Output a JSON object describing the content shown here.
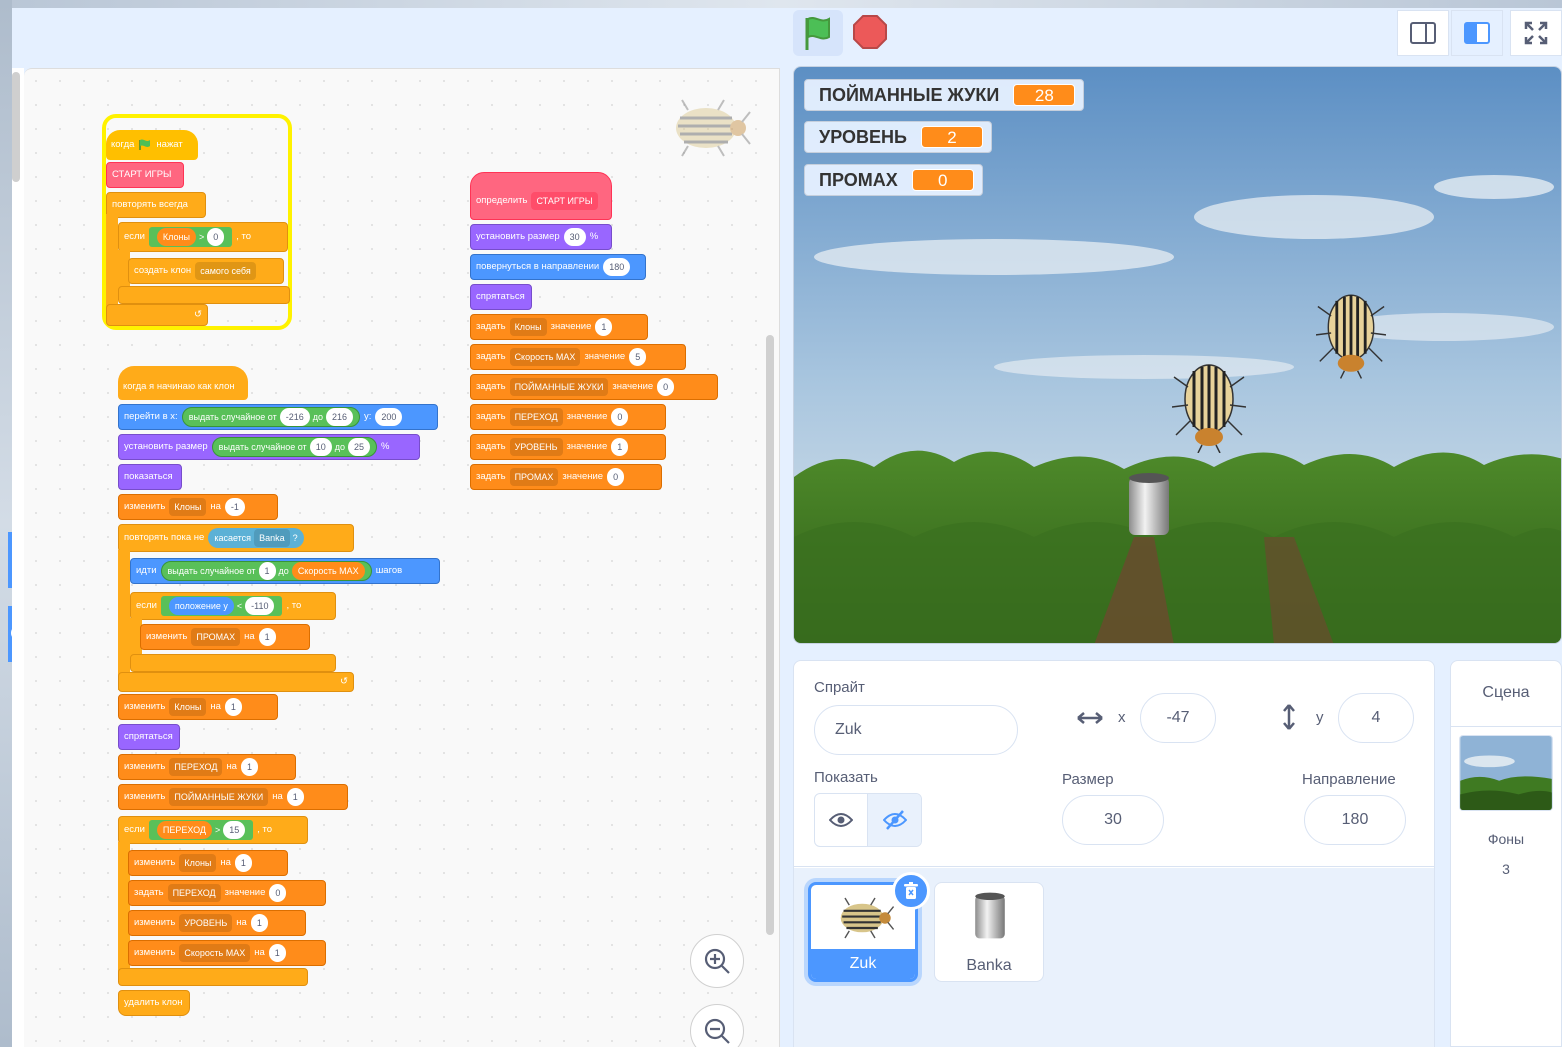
{
  "header": {
    "flag_icon": "green-flag-icon",
    "stop_icon": "stop-icon",
    "view_icons": [
      "small-stage-icon",
      "large-stage-icon",
      "fullscreen-icon"
    ]
  },
  "left_tab": {
    "partial_text": "e"
  },
  "scripts": {
    "s1": {
      "hat_when": "когда",
      "hat_clicked": "нажат",
      "call_start": "СТАРТ ИГРЫ",
      "forever": "повторять всегда",
      "if": "если",
      "then": ", то",
      "var_clones": "Клоны",
      "gt": ">",
      "zero": "0",
      "create_clone": "создать клон",
      "myself": "самого себя"
    },
    "s2": {
      "define": "определить",
      "proc_name": "СТАРТ ИГРЫ",
      "set_size": "установить размер",
      "size_val": "30",
      "percent": "%",
      "point_dir": "повернуться в направлении",
      "dir_val": "180",
      "hide": "спрятаться",
      "set": "задать",
      "to_value": "значение",
      "vars": [
        {
          "name": "Клоны",
          "val": "1"
        },
        {
          "name": "Скорость MAX",
          "val": "5"
        },
        {
          "name": "ПОЙМАННЫЕ ЖУКИ",
          "val": "0"
        },
        {
          "name": "ПЕРЕХОД",
          "val": "0"
        },
        {
          "name": "УРОВЕНЬ",
          "val": "1"
        },
        {
          "name": "ПРОМАХ",
          "val": "0"
        }
      ]
    },
    "s3": {
      "hat": "когда я начинаю как клон",
      "goto": "перейти в x:",
      "pick_random": "выдать случайное от",
      "to": "до",
      "rand_lo": "-216",
      "rand_hi": "216",
      "y_lbl": "y:",
      "y_val": "200",
      "set_size": "установить размер",
      "size_lo": "10",
      "size_hi": "25",
      "percent": "%",
      "show": "показаться",
      "change": "изменить",
      "by": "на",
      "clones": "Клоны",
      "minus_one": "-1",
      "repeat_until": "повторять пока не",
      "touching": "касается",
      "banka": "Banka",
      "q": "?",
      "move": "идти",
      "one": "1",
      "speed_max": "Скорость MAX",
      "steps": "шагов",
      "if": "если",
      "y_pos": "положение y",
      "lt": "<",
      "minus110": "-110",
      "then": ", то",
      "miss": "ПРОМАХ",
      "hide": "спрятаться",
      "transition": "ПЕРЕХОД",
      "caught": "ПОЙМАННЫЕ ЖУКИ",
      "gt": ">",
      "fifteen": "15",
      "set": "задать",
      "to_value": "значение",
      "zero": "0",
      "level": "УРОВЕНЬ",
      "delete_clone": "удалить клон"
    }
  },
  "stage": {
    "monitors": [
      {
        "label": "ПОЙМАННЫЕ ЖУКИ",
        "value": "28"
      },
      {
        "label": "УРОВЕНЬ",
        "value": "2"
      },
      {
        "label": "ПРОМАХ",
        "value": "0"
      }
    ]
  },
  "sprite_info": {
    "sprite_label": "Спрайт",
    "sprite_name": "Zuk",
    "x_label": "x",
    "x_value": "-47",
    "y_label": "y",
    "y_value": "4",
    "show_label": "Показать",
    "size_label": "Размер",
    "size_value": "30",
    "direction_label": "Направление",
    "direction_value": "180"
  },
  "sprites": [
    {
      "name": "Zuk",
      "selected": true
    },
    {
      "name": "Banka",
      "selected": false
    }
  ],
  "stage_panel": {
    "title": "Сцена",
    "backdrops_label": "Фоны",
    "backdrops_count": "3"
  },
  "colors": {
    "events": "#ffbf00",
    "control": "#ffab19",
    "variables": "#ff8c1a",
    "motion": "#4c97ff",
    "looks": "#9966ff",
    "operators": "#59c059",
    "sensing": "#5cb1d6",
    "my_blocks": "#ff6680",
    "selected_sprite": "#4c97ff"
  }
}
